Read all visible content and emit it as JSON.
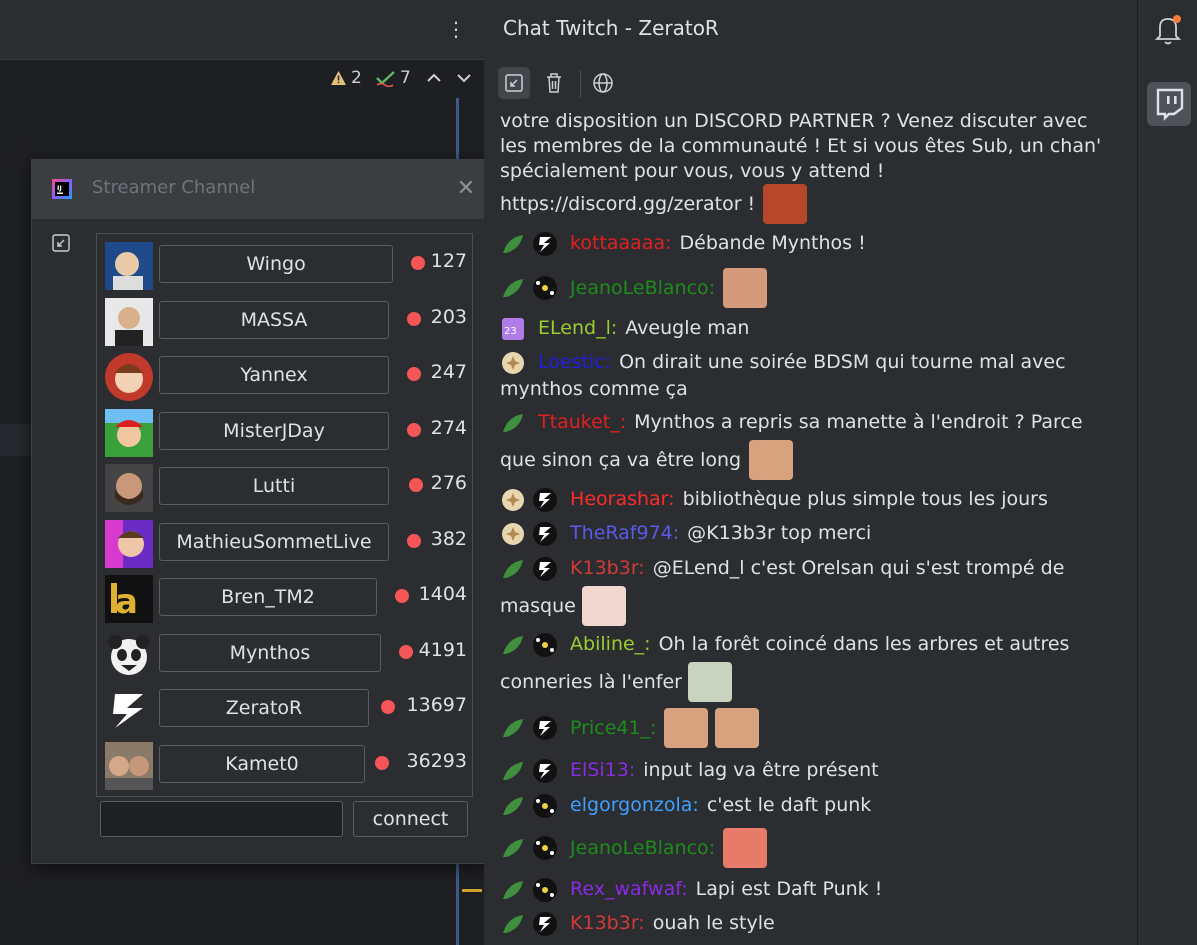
{
  "editor": {
    "warnings": "2",
    "checks": "7"
  },
  "popup": {
    "title": "Streamer Channel",
    "streamers": [
      {
        "name": "Wingo",
        "viewers": "127"
      },
      {
        "name": "MASSA",
        "viewers": "203"
      },
      {
        "name": "Yannex",
        "viewers": "247"
      },
      {
        "name": "MisterJDay",
        "viewers": "274"
      },
      {
        "name": "Lutti",
        "viewers": "276"
      },
      {
        "name": "MathieuSommetLive",
        "viewers": "382"
      },
      {
        "name": "Bren_TM2",
        "viewers": "1404"
      },
      {
        "name": "Mynthos",
        "viewers": "4191"
      },
      {
        "name": "ZeratoR",
        "viewers": "13697"
      },
      {
        "name": "Kamet0",
        "viewers": "36293"
      }
    ],
    "channel_input_value": "",
    "connect_label": "connect"
  },
  "chat": {
    "title": "Chat Twitch - ZeratoR",
    "intro_line1": "votre disposition un DISCORD PARTNER ? Venez discuter avec",
    "intro_line2": "les membres de la communauté ! Et si vous êtes Sub, un chan'",
    "intro_line3": "spécialement pour vous, vous y attend !",
    "intro_line4": "https://discord.gg/zerator !",
    "messages": [
      {
        "user": "kottaaaaa:",
        "color": "#e02020",
        "text": "Débande Mynthos !"
      },
      {
        "user": "JeanoLeBlanco:",
        "color": "#1d8c1d",
        "text": ""
      },
      {
        "user": "ELend_l:",
        "color": "#9acd32",
        "text": "Aveugle man"
      },
      {
        "user": "Loestic:",
        "color": "#2020e0",
        "text": "On dirait une soirée BDSM qui tourne mal avec"
      },
      {
        "user": "",
        "color": "#dfe1e5",
        "text": "mynthos comme ça"
      },
      {
        "user": "Ttauket_:",
        "color": "#e02020",
        "text": "Mynthos a repris sa manette à l'endroit ? Parce"
      },
      {
        "user": "",
        "color": "#dfe1e5",
        "text": "que sinon ça va être long"
      },
      {
        "user": "Heorashar:",
        "color": "#ff2a2a",
        "text": "bibliothèque plus simple tous les jours"
      },
      {
        "user": "TheRaf974:",
        "color": "#5a5ae8",
        "text": "@K13b3r top merci"
      },
      {
        "user": "K13b3r:",
        "color": "#d23a3a",
        "text": "@ELend_l c'est Orelsan qui s'est trompé de"
      },
      {
        "user": "",
        "color": "#dfe1e5",
        "text": "masque"
      },
      {
        "user": "Abiline_:",
        "color": "#9acd32",
        "text": "Oh la forêt coincé dans les arbres et autres"
      },
      {
        "user": "",
        "color": "#dfe1e5",
        "text": "conneries là l'enfer"
      },
      {
        "user": "Price41_:",
        "color": "#1d8c1d",
        "text": ""
      },
      {
        "user": "ElSi13:",
        "color": "#8a2be2",
        "text": "input lag va être présent"
      },
      {
        "user": "elgorgonzola:",
        "color": "#3ea0ff",
        "text": "c'est le daft punk"
      },
      {
        "user": "JeanoLeBlanco:",
        "color": "#1d8c1d",
        "text": ""
      },
      {
        "user": "Rex_wafwaf:",
        "color": "#8a2be2",
        "text": "Lapi est Daft Punk !"
      },
      {
        "user": "K13b3r:",
        "color": "#d23a3a",
        "text": "ouah le style"
      }
    ]
  },
  "icons": {
    "kebab": "more-vertical-icon",
    "warning": "warning-icon",
    "check": "spellcheck-icon",
    "bell": "notification-bell-icon",
    "twitch": "twitch-icon"
  }
}
